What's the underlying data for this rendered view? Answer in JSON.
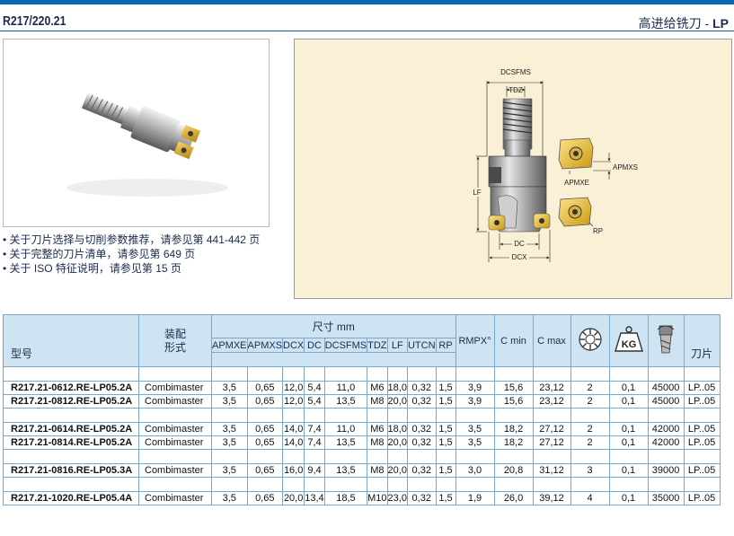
{
  "header": {
    "code": "R217/220.21",
    "title_cn": "高进给铣刀 - ",
    "title_lp": "LP",
    "accent_color": "#0b66b2"
  },
  "notes": [
    "关于刀片选择与切削参数推荐，请参见第 441-442 页",
    "关于完整的刀片清单，请参见第 649 页",
    "关于 ISO 特征说明，请参见第 15 页"
  ],
  "drawing_labels": {
    "dcsfms": "DCSFMS",
    "tdz": "TDZ",
    "lf": "LF",
    "dc": "DC",
    "dcx": "DCX",
    "apmxs": "APMXS",
    "apmxe": "APMXE",
    "rp": "RP"
  },
  "table": {
    "col_model": "型号",
    "col_fit": "装配\n形式",
    "group_dims": "尺寸 mm",
    "dim_cols": [
      "APMXE",
      "APMXS",
      "DCX",
      "DC",
      "DCSFMS",
      "TDZ",
      "LF",
      "UTCN",
      "RP"
    ],
    "col_rmpx": "RMPX°",
    "col_cmin": "C min",
    "col_cmax": "C max",
    "icon_teeth": "teeth-count-icon",
    "icon_weight_label": "KG",
    "icon_rpm": "max-rpm-icon",
    "col_insert": "刀片",
    "groups": [
      [
        {
          "model": "R217.21-0612.RE-LP05.2A",
          "fit": "Combimaster",
          "apmxe": "3,5",
          "apmxs": "0,65",
          "dcx": "12,0",
          "dc": "5,4",
          "dcsfms": "11,0",
          "tdz": "M6",
          "lf": "18,0",
          "utcn": "0,32",
          "rp": "1,5",
          "rmpx": "3,9",
          "cmin": "15,6",
          "cmax": "23,12",
          "teeth": "2",
          "kg": "0,1",
          "rpm": "45000",
          "insert": "LP..05"
        },
        {
          "model": "R217.21-0812.RE-LP05.2A",
          "fit": "Combimaster",
          "apmxe": "3,5",
          "apmxs": "0,65",
          "dcx": "12,0",
          "dc": "5,4",
          "dcsfms": "13,5",
          "tdz": "M8",
          "lf": "20,0",
          "utcn": "0,32",
          "rp": "1,5",
          "rmpx": "3,9",
          "cmin": "15,6",
          "cmax": "23,12",
          "teeth": "2",
          "kg": "0,1",
          "rpm": "45000",
          "insert": "LP..05"
        }
      ],
      [
        {
          "model": "R217.21-0614.RE-LP05.2A",
          "fit": "Combimaster",
          "apmxe": "3,5",
          "apmxs": "0,65",
          "dcx": "14,0",
          "dc": "7,4",
          "dcsfms": "11,0",
          "tdz": "M6",
          "lf": "18,0",
          "utcn": "0,32",
          "rp": "1,5",
          "rmpx": "3,5",
          "cmin": "18,2",
          "cmax": "27,12",
          "teeth": "2",
          "kg": "0,1",
          "rpm": "42000",
          "insert": "LP..05"
        },
        {
          "model": "R217.21-0814.RE-LP05.2A",
          "fit": "Combimaster",
          "apmxe": "3,5",
          "apmxs": "0,65",
          "dcx": "14,0",
          "dc": "7,4",
          "dcsfms": "13,5",
          "tdz": "M8",
          "lf": "20,0",
          "utcn": "0,32",
          "rp": "1,5",
          "rmpx": "3,5",
          "cmin": "18,2",
          "cmax": "27,12",
          "teeth": "2",
          "kg": "0,1",
          "rpm": "42000",
          "insert": "LP..05"
        }
      ],
      [
        {
          "model": "R217.21-0816.RE-LP05.3A",
          "fit": "Combimaster",
          "apmxe": "3,5",
          "apmxs": "0,65",
          "dcx": "16,0",
          "dc": "9,4",
          "dcsfms": "13,5",
          "tdz": "M8",
          "lf": "20,0",
          "utcn": "0,32",
          "rp": "1,5",
          "rmpx": "3,0",
          "cmin": "20,8",
          "cmax": "31,12",
          "teeth": "3",
          "kg": "0,1",
          "rpm": "39000",
          "insert": "LP..05"
        }
      ],
      [
        {
          "model": "R217.21-1020.RE-LP05.4A",
          "fit": "Combimaster",
          "apmxe": "3,5",
          "apmxs": "0,65",
          "dcx": "20,0",
          "dc": "13,4",
          "dcsfms": "18,5",
          "tdz": "M10",
          "lf": "23,0",
          "utcn": "0,32",
          "rp": "1,5",
          "rmpx": "1,9",
          "cmin": "26,0",
          "cmax": "39,12",
          "teeth": "4",
          "kg": "0,1",
          "rpm": "35000",
          "insert": "LP..05"
        }
      ]
    ]
  }
}
